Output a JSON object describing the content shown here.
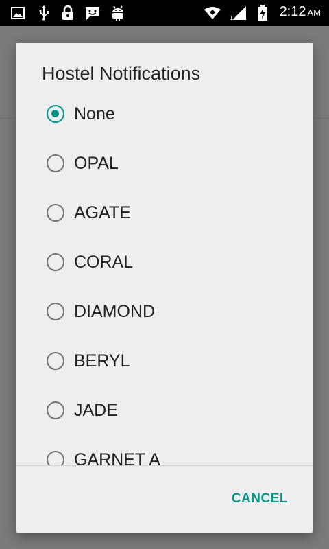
{
  "status_bar": {
    "time": "2:12",
    "ampm": "AM",
    "left_icons": [
      "image-icon",
      "usb-icon",
      "lock-icon",
      "message-icon",
      "android-debug-icon"
    ],
    "right_icons": [
      "wifi-icon",
      "signal-icon",
      "battery-charging-icon"
    ]
  },
  "dialog": {
    "title": "Hostel Notifications",
    "options": [
      {
        "label": "None",
        "checked": true
      },
      {
        "label": "OPAL",
        "checked": false
      },
      {
        "label": "AGATE",
        "checked": false
      },
      {
        "label": "CORAL",
        "checked": false
      },
      {
        "label": "DIAMOND",
        "checked": false
      },
      {
        "label": "BERYL",
        "checked": false
      },
      {
        "label": "JADE",
        "checked": false
      },
      {
        "label": "GARNET A",
        "checked": false
      }
    ],
    "cancel_label": "CANCEL"
  },
  "colors": {
    "accent": "#009688",
    "dialog_bg": "#eeeeee",
    "scrim": "#757575"
  }
}
